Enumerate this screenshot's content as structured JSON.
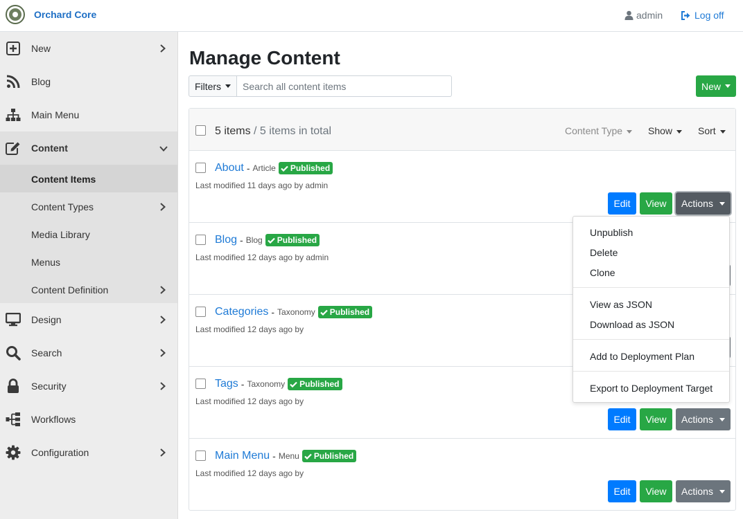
{
  "header": {
    "brand": "Orchard Core",
    "user": "admin",
    "logoff": "Log off"
  },
  "sidebar": {
    "items": [
      {
        "label": "New",
        "icon": "plus-square-icon"
      },
      {
        "label": "Blog",
        "icon": "rss-icon"
      },
      {
        "label": "Main Menu",
        "icon": "sitemap-icon"
      },
      {
        "label": "Content",
        "icon": "edit-icon"
      },
      {
        "label": "Design",
        "icon": "desktop-icon"
      },
      {
        "label": "Search",
        "icon": "search-icon"
      },
      {
        "label": "Security",
        "icon": "lock-icon"
      },
      {
        "label": "Workflows",
        "icon": "workflow-icon"
      },
      {
        "label": "Configuration",
        "icon": "cog-icon"
      }
    ],
    "content_sub": [
      {
        "label": "Content Items"
      },
      {
        "label": "Content Types"
      },
      {
        "label": "Media Library"
      },
      {
        "label": "Menus"
      },
      {
        "label": "Content Definition"
      }
    ]
  },
  "main": {
    "title": "Manage Content",
    "filters_label": "Filters",
    "search_placeholder": "Search all content items",
    "new_label": "New",
    "count": "5 items",
    "count_total": "/ 5 items in total",
    "content_type": "Content Type",
    "show": "Show",
    "sort": "Sort",
    "items": [
      {
        "title": "About",
        "type": "Article",
        "status": "Published",
        "modified": "Last modified 11 days ago by admin"
      },
      {
        "title": "Blog",
        "type": "Blog",
        "status": "Published",
        "modified": "Last modified 12 days ago by admin"
      },
      {
        "title": "Categories",
        "type": "Taxonomy",
        "status": "Published",
        "modified": "Last modified 12 days ago by"
      },
      {
        "title": "Tags",
        "type": "Taxonomy",
        "status": "Published",
        "modified": "Last modified 12 days ago by"
      },
      {
        "title": "Main Menu",
        "type": "Menu",
        "status": "Published",
        "modified": "Last modified 12 days ago by"
      }
    ],
    "edit_label": "Edit",
    "view_label": "View",
    "actions_label": "Actions"
  },
  "actions_menu": {
    "unpublish": "Unpublish",
    "delete": "Delete",
    "clone": "Clone",
    "view_json": "View as JSON",
    "download_json": "Download as JSON",
    "add_deployment": "Add to Deployment Plan",
    "export_deployment": "Export to Deployment Target"
  },
  "colors": {
    "primary": "#007bff",
    "success": "#28a745",
    "secondary": "#6c757d",
    "link": "#1e7ad6"
  }
}
